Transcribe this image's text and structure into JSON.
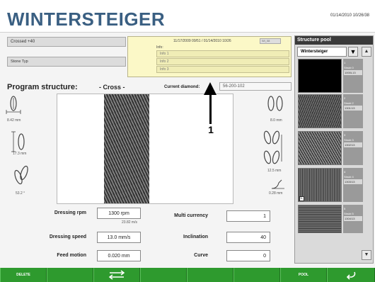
{
  "header": {
    "logo": "WINTERSTEIGER",
    "datetime": "01/14/2010 10/26/38"
  },
  "fields": {
    "stone_name": "Crossed +40",
    "stone_type": "Stone Typ"
  },
  "info_panel": {
    "dates": "11/17/2009 09/51  / 01/14/2010 10/26",
    "user": "Wi_08",
    "info_label": "Info:",
    "rows": [
      "Info 1",
      "Info 2",
      "Info 3"
    ]
  },
  "program": {
    "label": "Program structure:",
    "value": "- Cross -",
    "diamond_label": "Current diamond:",
    "diamond_value": "56-200-102"
  },
  "left_values": {
    "width": "8.42 mm",
    "depth": "17.3 mm",
    "angle": "53.2 °"
  },
  "right_values": {
    "width": "8.0 mm",
    "depth": "12.5 mm",
    "radius": "0.28 mm"
  },
  "form": {
    "dressing_rpm_label": "Dressing rpm",
    "dressing_rpm_value": "1300 rpm",
    "dressing_rpm_sub": "23.82 m/s",
    "dressing_speed_label": "Dressing speed",
    "dressing_speed_value": "13.0 mm/s",
    "feed_motion_label": "Feed motion",
    "feed_motion_value": "0.020 mm",
    "multi_currency_label": "Multi currency",
    "multi_currency_value": "1",
    "inclination_label": "Inclination",
    "inclination_value": "40",
    "curve_label": "Curve",
    "curve_value": "0"
  },
  "pool": {
    "title": "Structure pool",
    "selected": "Wintersteiger",
    "items": [
      {
        "num": "1",
        "name": "Strukt 0",
        "code": "1000L13"
      },
      {
        "num": "2",
        "name": "Strukt 2",
        "code": "1301/13"
      },
      {
        "num": "3",
        "name": "Strukt 3",
        "code": "1302/13"
      },
      {
        "num": "4",
        "name": "Strukt 4",
        "code": "1303/13"
      },
      {
        "num": "5",
        "name": "Strukt 5",
        "code": "1304/13"
      }
    ],
    "badge": "L"
  },
  "annotation": {
    "label": "1"
  },
  "toolbar": {
    "delete": "DELETE",
    "pool": "POOL"
  }
}
